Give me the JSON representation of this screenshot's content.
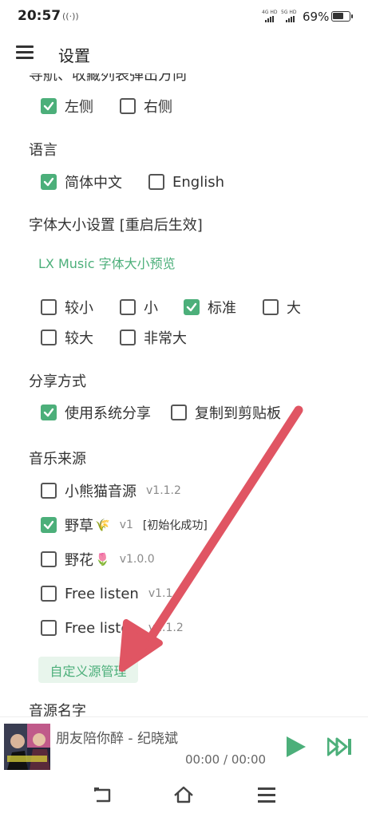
{
  "status_bar": {
    "time": "20:57",
    "hotspot_icon": "((·))",
    "net1": "4G HD",
    "net2": "5G HD",
    "battery": "69%",
    "battery_level": 0.69
  },
  "app_bar": {
    "title": "设置",
    "menu_icon": "hamburger-menu-icon"
  },
  "settings": {
    "nav_position": {
      "title": "导航、收藏列表弹出方向",
      "options": [
        {
          "label": "左侧",
          "checked": true
        },
        {
          "label": "右侧",
          "checked": false
        }
      ]
    },
    "language": {
      "title": "语言",
      "options": [
        {
          "label": "简体中文",
          "checked": true
        },
        {
          "label": "English",
          "checked": false
        }
      ]
    },
    "font_size": {
      "title": "字体大小设置 [重启后生效]",
      "preview": "LX Music 字体大小预览",
      "options": [
        {
          "label": "较小",
          "checked": false
        },
        {
          "label": "小",
          "checked": false
        },
        {
          "label": "标准",
          "checked": true
        },
        {
          "label": "大",
          "checked": false
        },
        {
          "label": "较大",
          "checked": false
        },
        {
          "label": "非常大",
          "checked": false
        }
      ]
    },
    "share": {
      "title": "分享方式",
      "options": [
        {
          "label": "使用系统分享",
          "checked": true
        },
        {
          "label": "复制到剪贴板",
          "checked": false
        }
      ]
    },
    "music_source": {
      "title": "音乐来源",
      "sources": [
        {
          "label": "小熊猫音源",
          "version": "v1.1.2",
          "note": "",
          "emoji": "",
          "checked": false
        },
        {
          "label": "野草",
          "emoji": "🌾",
          "version": "v1",
          "note": "[初始化成功]",
          "checked": true
        },
        {
          "label": "野花",
          "emoji": "🌷",
          "version": "v1.0.0",
          "note": "",
          "checked": false
        },
        {
          "label": "Free listen",
          "emoji": "",
          "version": "v1.1.2",
          "note": "",
          "checked": false
        },
        {
          "label": "Free listen",
          "emoji": "",
          "version": "v1.1.2",
          "note": "",
          "checked": false
        }
      ],
      "custom_button": "自定义源管理"
    },
    "source_name": {
      "title": "音源名字"
    }
  },
  "player": {
    "title": "朋友陪你醉 - 纪晓斌",
    "time": "00:00 / 00:00",
    "play_icon": "play-icon",
    "next_icon": "skip-next-icon",
    "accent": "#4caf7a"
  },
  "nav_bar": {
    "back": "back-icon",
    "home": "home-icon",
    "menu": "recent-apps-icon"
  },
  "colors": {
    "accent": "#4caf7a",
    "annotation_arrow": "#e05563"
  }
}
